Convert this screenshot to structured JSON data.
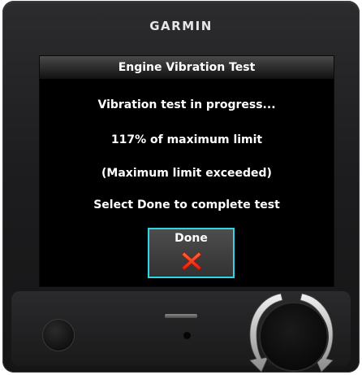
{
  "device": {
    "brand": "GARMIN"
  },
  "dialog": {
    "title": "Engine Vibration Test",
    "status": "Vibration test in progress...",
    "level": "117% of maximum limit",
    "warning": "(Maximum limit exceeded)",
    "instruction": "Select Done to complete test",
    "done_button": {
      "label": "Done",
      "icon": "red-x-icon"
    }
  },
  "colors": {
    "highlight": "#2fd6e6",
    "x_icon": "#ff3b1a",
    "text": "#ffffff",
    "screen_bg": "#000000"
  },
  "controls": {
    "left_knob_icon": "small-knob",
    "right_knob_icon": "dual-concentric-knob"
  }
}
